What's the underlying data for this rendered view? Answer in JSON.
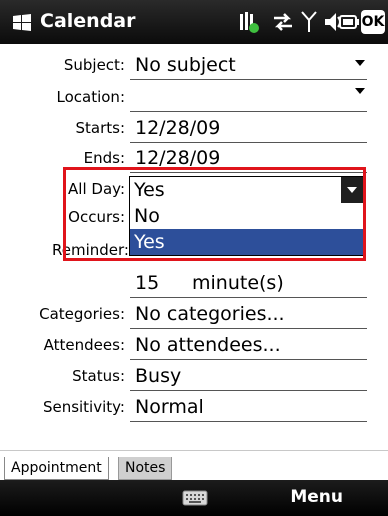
{
  "titlebar": {
    "title": "Calendar",
    "ok_label": "OK"
  },
  "form": {
    "subject": {
      "label": "Subject:",
      "value": "No subject"
    },
    "location": {
      "label": "Location:",
      "value": ""
    },
    "starts": {
      "label": "Starts:",
      "value": "12/28/09"
    },
    "ends": {
      "label": "Ends:",
      "value": "12/28/09"
    },
    "all_day": {
      "label": "All Day:",
      "value": "Yes",
      "options": [
        "No",
        "Yes"
      ],
      "selected": "Yes"
    },
    "occurs": {
      "label": "Occurs:"
    },
    "reminder": {
      "label": "Reminder:",
      "amount": "15",
      "unit": "minute(s)"
    },
    "categories": {
      "label": "Categories:",
      "value": "No categories..."
    },
    "attendees": {
      "label": "Attendees:",
      "value": "No attendees..."
    },
    "status": {
      "label": "Status:",
      "value": "Busy"
    },
    "sensitivity": {
      "label": "Sensitivity:",
      "value": "Normal"
    }
  },
  "tabs": [
    {
      "label": "Appointment",
      "active": true
    },
    {
      "label": "Notes",
      "active": false
    }
  ],
  "softkeys": {
    "right": "Menu",
    "center_icon": "keyboard-icon"
  },
  "colors": {
    "selection": "#2d4f9a",
    "highlight": "#e0141b",
    "titlebar": "#111111"
  }
}
